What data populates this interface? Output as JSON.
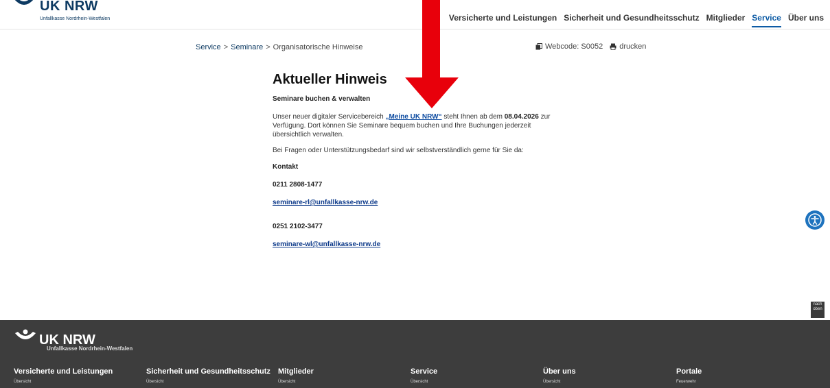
{
  "header": {
    "logo_title": "UK NRW",
    "logo_sub": "Unfallkasse Nordrhein-Westfalen",
    "nav": [
      {
        "label": "Versicherte und Leistungen"
      },
      {
        "label": "Sicherheit und Gesundheitsschutz"
      },
      {
        "label": "Mitglieder"
      },
      {
        "label": "Service",
        "active": true
      },
      {
        "label": "Über uns"
      }
    ]
  },
  "breadcrumb": {
    "items": [
      "Service",
      "Seminare",
      "Organisatorische Hinweise"
    ],
    "separator": ">"
  },
  "meta": {
    "webcode": "Webcode: S0052",
    "print": "drucken"
  },
  "content": {
    "title": "Aktueller Hinweis",
    "subheading": "Seminare buchen & verwalten",
    "para1_before": "Unser neuer digitaler Servicebereich ",
    "para1_link": "„Meine UK NRW“",
    "para1_mid": " steht Ihnen ab dem ",
    "para1_date": "08.04.2026",
    "para1_after": " zur Verfügung. Dort können Sie Seminare bequem buchen und Ihre Buchungen jederzeit übersichtlich verwalten.",
    "para2": "Bei Fragen oder Unterstützungsbedarf sind wir selbstverständlich gerne für Sie da:",
    "contact_label": "Kontakt",
    "phone1": "0211 2808-1477",
    "email1": "seminare-rl@unfallkasse-nrw.de",
    "phone2": "0251 2102-3477",
    "email2": "seminare-wl@unfallkasse-nrw.de"
  },
  "floating": {
    "totop_label": "nach oben"
  },
  "footer": {
    "logo_title": "UK NRW",
    "logo_sub": "Unfallkasse Nordrhein-Westfalen",
    "columns": [
      {
        "title": "Versicherte und Leistungen",
        "sub": "Übersicht"
      },
      {
        "title": "Sicherheit und Gesundheitsschutz",
        "sub": "Übersicht"
      },
      {
        "title": "Mitglieder",
        "sub": "Übersicht"
      },
      {
        "title": "Service",
        "sub": "Übersicht"
      },
      {
        "title": "Über uns",
        "sub": "Übersicht"
      },
      {
        "title": "Portale",
        "sub": "Feuerwehr"
      }
    ]
  },
  "colors": {
    "brand": "#0d3a62",
    "accent": "#1e73be",
    "arrow": "#e8000b",
    "footer_bg": "#3d3d3d"
  }
}
